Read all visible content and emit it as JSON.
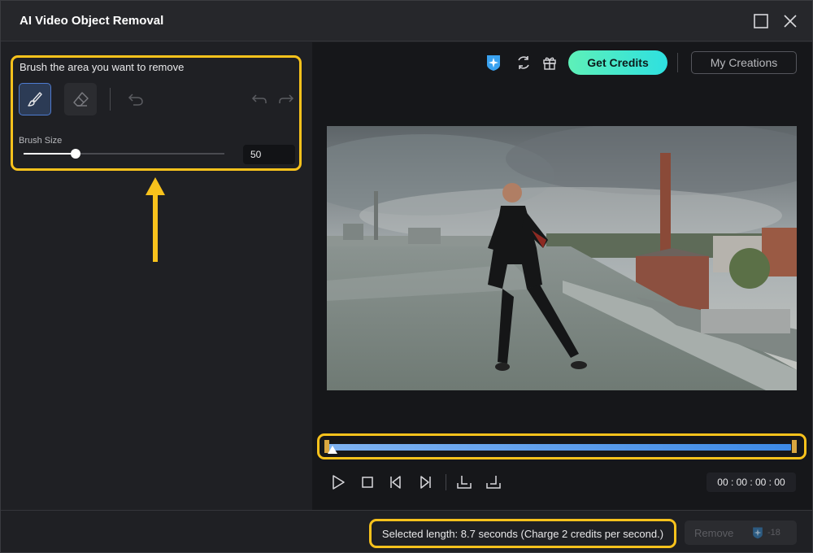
{
  "window": {
    "title": "AI Video Object Removal"
  },
  "left_panel": {
    "instruction": "Brush the area you want to remove",
    "brush_size_label": "Brush Size",
    "brush_size_value": "50",
    "brush_size_fraction": 0.26
  },
  "toolbar": {
    "get_credits_label": "Get Credits",
    "my_creations_label": "My Creations",
    "icons": [
      "ai-credit-icon",
      "refresh-icon",
      "gift-icon"
    ]
  },
  "player": {
    "timecode": "00 : 00 : 00 : 00",
    "controls": [
      "play-icon",
      "stop-icon",
      "prev-frame-icon",
      "next-frame-icon",
      "set-in-point-icon",
      "set-out-point-icon"
    ]
  },
  "footer": {
    "selected_length_text": "Selected length: 8.7 seconds (Charge 2 credits per second.)",
    "remove_label": "Remove",
    "remove_credits": "-18"
  },
  "colors": {
    "highlight": "#f8c21c",
    "accent_gradient_start": "#5ef0b8",
    "accent_gradient_end": "#2ee0e0",
    "timeline_blue": "#3d8ae6"
  }
}
